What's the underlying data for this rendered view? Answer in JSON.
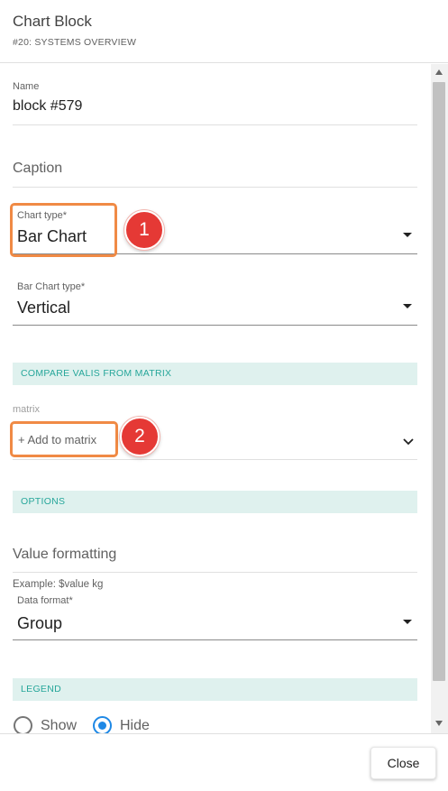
{
  "dialog": {
    "title": "Chart Block",
    "subtitle": "#20: SYSTEMS OVERVIEW"
  },
  "fields": {
    "name": {
      "label": "Name",
      "value": "block #579"
    },
    "caption": {
      "placeholder": "Caption"
    },
    "chart_type": {
      "label": "Chart type*",
      "value": "Bar Chart"
    },
    "bar_chart_type": {
      "label": "Bar Chart type*",
      "value": "Vertical"
    },
    "matrix": {
      "label": "matrix",
      "add_label": "+ Add to matrix"
    },
    "value_formatting": {
      "placeholder": "Value formatting",
      "hint": "Example: $value kg"
    },
    "data_format": {
      "label": "Data format*",
      "value": "Group"
    }
  },
  "sections": {
    "compare": "COMPARE VALIS FROM MATRIX",
    "options": "OPTIONS",
    "legend": "LEGEND"
  },
  "legend_radio": {
    "show_label": "Show",
    "hide_label": "Hide",
    "selected": "Hide"
  },
  "annotations": {
    "badge_1": "1",
    "badge_2": "2"
  },
  "footer": {
    "close_label": "Close"
  },
  "colors": {
    "accent_teal": "#26a69a",
    "section_bg": "#dff1ee",
    "highlight_orange": "#f08a45",
    "badge_red": "#e53935",
    "radio_blue": "#1e88e5"
  },
  "icons": {
    "dropdown": "caret-down-icon",
    "expand": "chevron-down-icon"
  }
}
